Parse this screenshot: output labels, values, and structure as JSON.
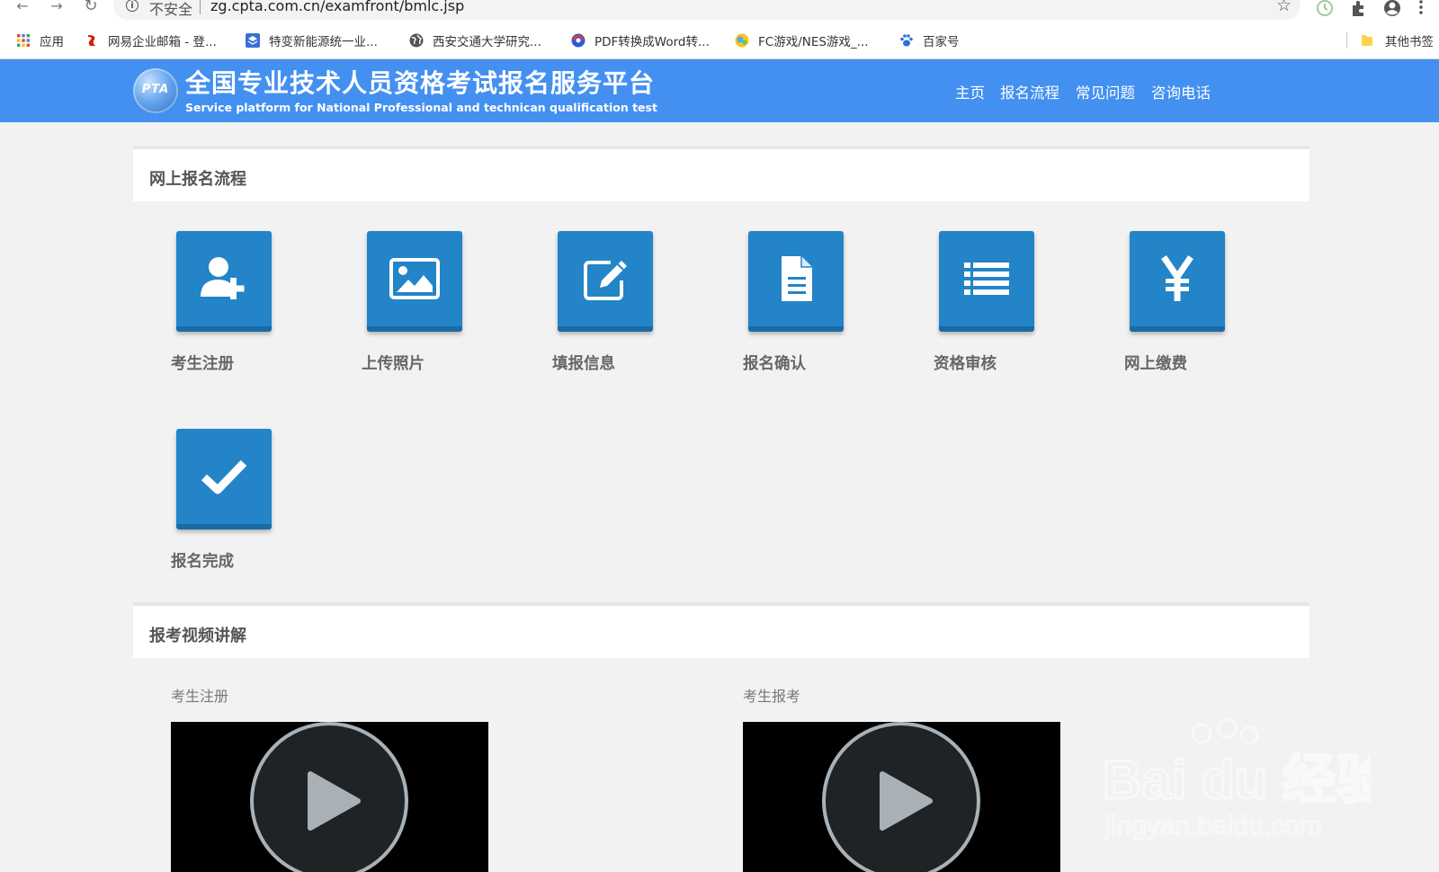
{
  "browser": {
    "security_label": "不安全",
    "url": "zg.cpta.com.cn/examfront/bmlc.jsp",
    "bookmarks": [
      {
        "label": "应用",
        "icon": "apps-grid-icon"
      },
      {
        "label": "网易企业邮箱 - 登...",
        "icon": "netease-icon"
      },
      {
        "label": "特变新能源统一业...",
        "icon": "layers-icon"
      },
      {
        "label": "西安交通大学研究...",
        "icon": "globe-icon"
      },
      {
        "label": "PDF转换成Word转...",
        "icon": "pdf-convert-icon"
      },
      {
        "label": "FC游戏/NES游戏_...",
        "icon": "game-icon"
      },
      {
        "label": "百家号",
        "icon": "baidu-paw-icon"
      }
    ],
    "other_bookmarks": "其他书签"
  },
  "header": {
    "logo_text": "PTA",
    "title": "全国专业技术人员资格考试报名服务平台",
    "subtitle": "Service platform for National Professional and technican qualification test",
    "nav": [
      "主页",
      "报名流程",
      "常见问题",
      "咨询电话"
    ],
    "brand_color": "#4390f1"
  },
  "process": {
    "title": "网上报名流程",
    "tile_color": "#2384c8",
    "steps": [
      {
        "label": "考生注册",
        "icon": "user-add-icon"
      },
      {
        "label": "上传照片",
        "icon": "image-icon"
      },
      {
        "label": "填报信息",
        "icon": "edit-icon"
      },
      {
        "label": "报名确认",
        "icon": "document-icon"
      },
      {
        "label": "资格审核",
        "icon": "list-icon"
      },
      {
        "label": "网上缴费",
        "icon": "yen-icon"
      },
      {
        "label": "报名完成",
        "icon": "check-icon"
      }
    ]
  },
  "videos": {
    "title": "报考视频讲解",
    "items": [
      {
        "label": "考生注册"
      },
      {
        "label": "考生报考"
      }
    ]
  },
  "watermark": {
    "brand": "Bai du 经验",
    "domain": "jingyan.baidu.com"
  }
}
